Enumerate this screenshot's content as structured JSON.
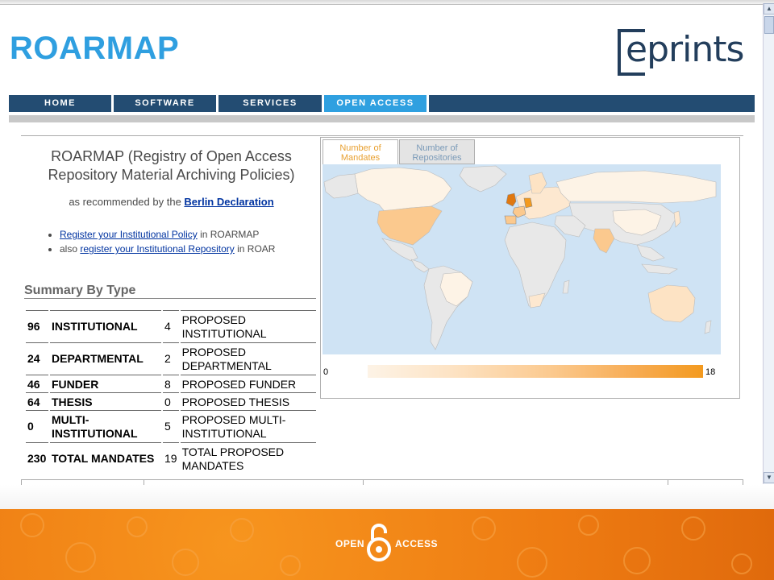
{
  "header": {
    "site_title": "ROARMAP",
    "logo_text": "eprints"
  },
  "nav": {
    "items": [
      {
        "label": "HOME"
      },
      {
        "label": "SOFTWARE"
      },
      {
        "label": "SERVICES"
      },
      {
        "label": "OPEN ACCESS",
        "active": true
      }
    ]
  },
  "intro": {
    "title": "ROARMAP (Registry of Open Access Repository Material Archiving Policies)",
    "subtitle_prefix": "as recommended by the ",
    "subtitle_link": "Berlin Declaration",
    "bullets": [
      {
        "prefix": "",
        "link": "Register your Institutional Policy",
        "suffix": " in ROARMAP"
      },
      {
        "prefix": "also ",
        "link": "register your Institutional Repository",
        "suffix": " in ROAR"
      }
    ]
  },
  "summary": {
    "title": "Summary By Type",
    "rows": [
      {
        "count": "96",
        "type": "INSTITUTIONAL",
        "proposed_count": "4",
        "proposed_type": "PROPOSED INSTITUTIONAL"
      },
      {
        "count": "24",
        "type": "DEPARTMENTAL",
        "proposed_count": "2",
        "proposed_type": "PROPOSED DEPARTMENTAL"
      },
      {
        "count": "46",
        "type": "FUNDER",
        "proposed_count": "8",
        "proposed_type": "PROPOSED FUNDER"
      },
      {
        "count": "64",
        "type": "THESIS",
        "proposed_count": "0",
        "proposed_type": "PROPOSED THESIS"
      },
      {
        "count": "0",
        "type": "MULTI-INSTITUTIONAL",
        "proposed_count": "5",
        "proposed_type": "PROPOSED MULTI-INSTITUTIONAL"
      },
      {
        "count": "230",
        "type": "TOTAL MANDATES",
        "proposed_count": "19",
        "proposed_type": "TOTAL PROPOSED MANDATES"
      }
    ]
  },
  "map": {
    "tabs": [
      {
        "label": "Number of Mandates",
        "active": true
      },
      {
        "label": "Number of Repositories",
        "active": false
      }
    ],
    "legend_min": "0",
    "legend_max": "18",
    "colors": {
      "ocean": "#cfe3f4",
      "no_data": "#e8e8e8",
      "low": "#fde8d0",
      "mid": "#fbc98e",
      "high": "#f39a1f",
      "top": "#e07810"
    }
  },
  "footer": {
    "logo_left": "OPEN",
    "logo_right": "ACCESS"
  },
  "colors": {
    "title_blue": "#2f9fe0",
    "nav_blue": "#234c72",
    "nav_active": "#2fa0e0",
    "footer_orange": "#f08a1a"
  }
}
